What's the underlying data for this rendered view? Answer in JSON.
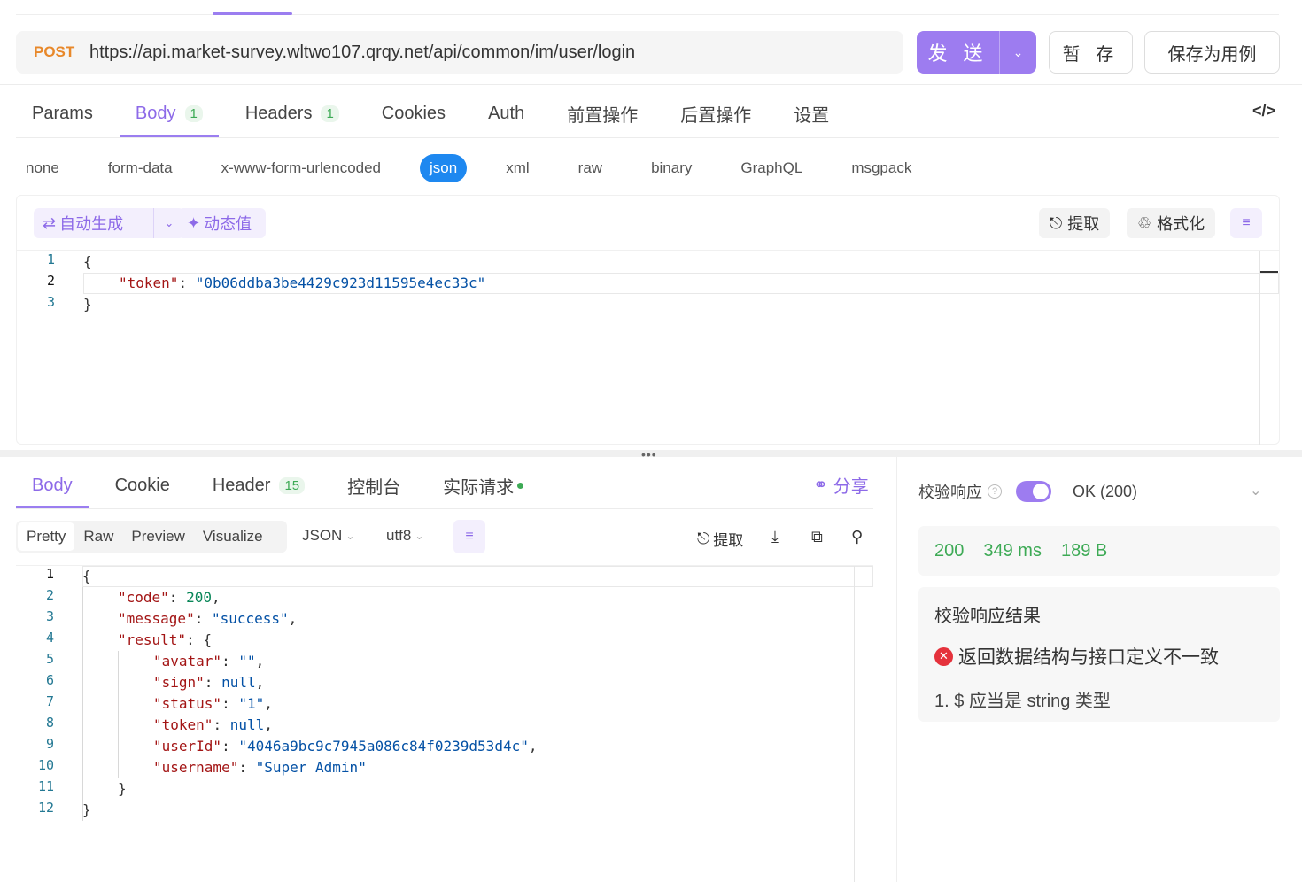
{
  "request": {
    "method": "POST",
    "url": "https://api.market-survey.wltwo107.qrqy.net/api/common/im/user/login",
    "send_label": "发 送",
    "save_label": "暂 存",
    "save_case_label": "保存为用例",
    "tabs": [
      {
        "label": "Params"
      },
      {
        "label": "Body",
        "badge": "1"
      },
      {
        "label": "Headers",
        "badge": "1"
      },
      {
        "label": "Cookies"
      },
      {
        "label": "Auth"
      },
      {
        "label": "前置操作"
      },
      {
        "label": "后置操作"
      },
      {
        "label": "设置"
      }
    ],
    "code_toggle": "</>",
    "body_types": [
      "none",
      "form-data",
      "x-www-form-urlencoded",
      "json",
      "xml",
      "raw",
      "binary",
      "GraphQL",
      "msgpack"
    ],
    "active_body_type": "json",
    "editor_toolbar": {
      "auto_generate": "自动生成",
      "dynamic_value": "动态值",
      "extract": "提取",
      "format": "格式化"
    },
    "body_lines": [
      {
        "n": "1",
        "text": "{"
      },
      {
        "n": "2",
        "key": "\"token\"",
        "sep": ": ",
        "value": "\"0b06ddba3be4429c923d11595e4ec33c\""
      },
      {
        "n": "3",
        "text": "}"
      }
    ]
  },
  "response": {
    "tabs": [
      {
        "label": "Body"
      },
      {
        "label": "Cookie"
      },
      {
        "label": "Header",
        "badge": "15"
      },
      {
        "label": "控制台"
      },
      {
        "label": "实际请求"
      }
    ],
    "share_label": "分享",
    "view_modes": [
      "Pretty",
      "Raw",
      "Preview",
      "Visualize"
    ],
    "format_select": "JSON",
    "encoding_select": "utf8",
    "extract_label": "提取",
    "lines": [
      {
        "n": "1",
        "indent": 0,
        "parts": [
          {
            "t": "{",
            "c": "p"
          }
        ]
      },
      {
        "n": "2",
        "indent": 1,
        "parts": [
          {
            "t": "\"code\"",
            "c": "key"
          },
          {
            "t": ": ",
            "c": "p"
          },
          {
            "t": "200",
            "c": "num"
          },
          {
            "t": ",",
            "c": "p"
          }
        ]
      },
      {
        "n": "3",
        "indent": 1,
        "parts": [
          {
            "t": "\"message\"",
            "c": "key"
          },
          {
            "t": ": ",
            "c": "p"
          },
          {
            "t": "\"success\"",
            "c": "str"
          },
          {
            "t": ",",
            "c": "p"
          }
        ]
      },
      {
        "n": "4",
        "indent": 1,
        "parts": [
          {
            "t": "\"result\"",
            "c": "key"
          },
          {
            "t": ": {",
            "c": "p"
          }
        ]
      },
      {
        "n": "5",
        "indent": 2,
        "parts": [
          {
            "t": "\"avatar\"",
            "c": "key"
          },
          {
            "t": ": ",
            "c": "p"
          },
          {
            "t": "\"\"",
            "c": "str"
          },
          {
            "t": ",",
            "c": "p"
          }
        ]
      },
      {
        "n": "6",
        "indent": 2,
        "parts": [
          {
            "t": "\"sign\"",
            "c": "key"
          },
          {
            "t": ": ",
            "c": "p"
          },
          {
            "t": "null",
            "c": "kw"
          },
          {
            "t": ",",
            "c": "p"
          }
        ]
      },
      {
        "n": "7",
        "indent": 2,
        "parts": [
          {
            "t": "\"status\"",
            "c": "key"
          },
          {
            "t": ": ",
            "c": "p"
          },
          {
            "t": "\"1\"",
            "c": "str"
          },
          {
            "t": ",",
            "c": "p"
          }
        ]
      },
      {
        "n": "8",
        "indent": 2,
        "parts": [
          {
            "t": "\"token\"",
            "c": "key"
          },
          {
            "t": ": ",
            "c": "p"
          },
          {
            "t": "null",
            "c": "kw"
          },
          {
            "t": ",",
            "c": "p"
          }
        ]
      },
      {
        "n": "9",
        "indent": 2,
        "parts": [
          {
            "t": "\"userId\"",
            "c": "key"
          },
          {
            "t": ": ",
            "c": "p"
          },
          {
            "t": "\"4046a9bc9c7945a086c84f0239d53d4c\"",
            "c": "str"
          },
          {
            "t": ",",
            "c": "p"
          }
        ]
      },
      {
        "n": "10",
        "indent": 2,
        "parts": [
          {
            "t": "\"username\"",
            "c": "key"
          },
          {
            "t": ": ",
            "c": "p"
          },
          {
            "t": "\"Super Admin\"",
            "c": "str"
          }
        ]
      },
      {
        "n": "11",
        "indent": 1,
        "parts": [
          {
            "t": "}",
            "c": "p"
          }
        ]
      },
      {
        "n": "12",
        "indent": 0,
        "parts": [
          {
            "t": "}",
            "c": "p"
          }
        ]
      }
    ]
  },
  "validation": {
    "label": "校验响应",
    "help": "?",
    "enabled": true,
    "status_option": "OK (200)",
    "status_code": "200",
    "time": "349 ms",
    "size": "189 B",
    "result_title": "校验响应结果",
    "error": "返回数据结构与接口定义不一致",
    "error_detail": "1. $ 应当是 string 类型"
  },
  "colors": {
    "accent": "#9d7cf0",
    "method": "#e8882a",
    "json_active": "#1e88f0",
    "success": "#3daa55",
    "error": "#e5323c"
  }
}
